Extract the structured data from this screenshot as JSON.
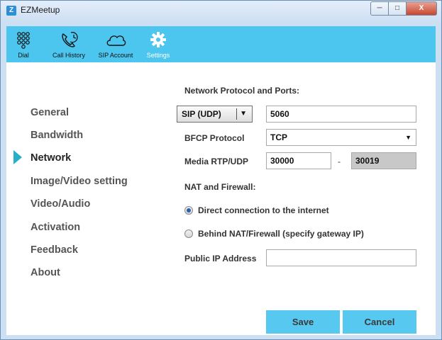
{
  "window": {
    "title": "EZMeetup",
    "minimize": "─",
    "maximize": "□",
    "close": "X"
  },
  "toolbar": {
    "items": [
      {
        "label": "Dial",
        "icon": "dialpad-icon"
      },
      {
        "label": "Call History",
        "icon": "phone-history-icon"
      },
      {
        "label": "SIP Account",
        "icon": "cloud-icon"
      },
      {
        "label": "Settings",
        "icon": "gear-icon",
        "active": true
      }
    ],
    "bg_color": "#4cc6ee"
  },
  "nav": {
    "items": [
      "General",
      "Bandwidth",
      "Network",
      "Image/Video setting",
      "Video/Audio",
      "Activation",
      "Feedback",
      "About"
    ],
    "selected": "Network",
    "marker_color": "#26b0c8"
  },
  "network": {
    "section_title": "Network Protocol and Ports:",
    "protocol": {
      "value": "SIP (UDP)",
      "arrow": "▼"
    },
    "port": "5060",
    "bfcp": {
      "label": "BFCP Protocol",
      "value": "TCP",
      "arrow": "▼"
    },
    "media": {
      "label": "Media RTP/UDP",
      "from": "30000",
      "dash": "-",
      "to": "30019"
    },
    "nat_title": "NAT and Firewall:",
    "radio_direct": "Direct connection to the internet",
    "radio_behind": "Behind NAT/Firewall (specify gateway IP)",
    "public_ip_label": "Public IP Address",
    "public_ip_value": ""
  },
  "buttons": {
    "save": "Save",
    "cancel": "Cancel"
  }
}
